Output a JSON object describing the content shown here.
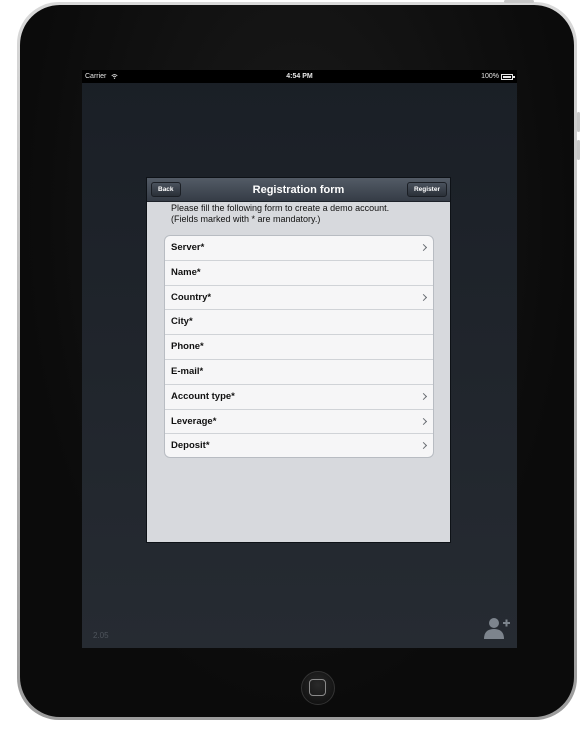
{
  "status_bar": {
    "carrier": "Carrier",
    "time": "4:54 PM",
    "battery": "100%"
  },
  "navbar": {
    "back_label": "Back",
    "title": "Registration form",
    "register_label": "Register"
  },
  "intro": {
    "line1": "Please fill the following form to create a demo account.",
    "line2": "(Fields marked with * are mandatory.)"
  },
  "form": {
    "fields": [
      {
        "label": "Server*",
        "has_chevron": true
      },
      {
        "label": "Name*",
        "has_chevron": false
      },
      {
        "label": "Country*",
        "has_chevron": true
      },
      {
        "label": "City*",
        "has_chevron": false
      },
      {
        "label": "Phone*",
        "has_chevron": false
      },
      {
        "label": "E-mail*",
        "has_chevron": false
      },
      {
        "label": "Account type*",
        "has_chevron": true
      },
      {
        "label": "Leverage*",
        "has_chevron": true
      },
      {
        "label": "Deposit*",
        "has_chevron": true
      }
    ]
  },
  "footer": {
    "version": "2.05",
    "add_user_icon": "add-user-icon"
  }
}
